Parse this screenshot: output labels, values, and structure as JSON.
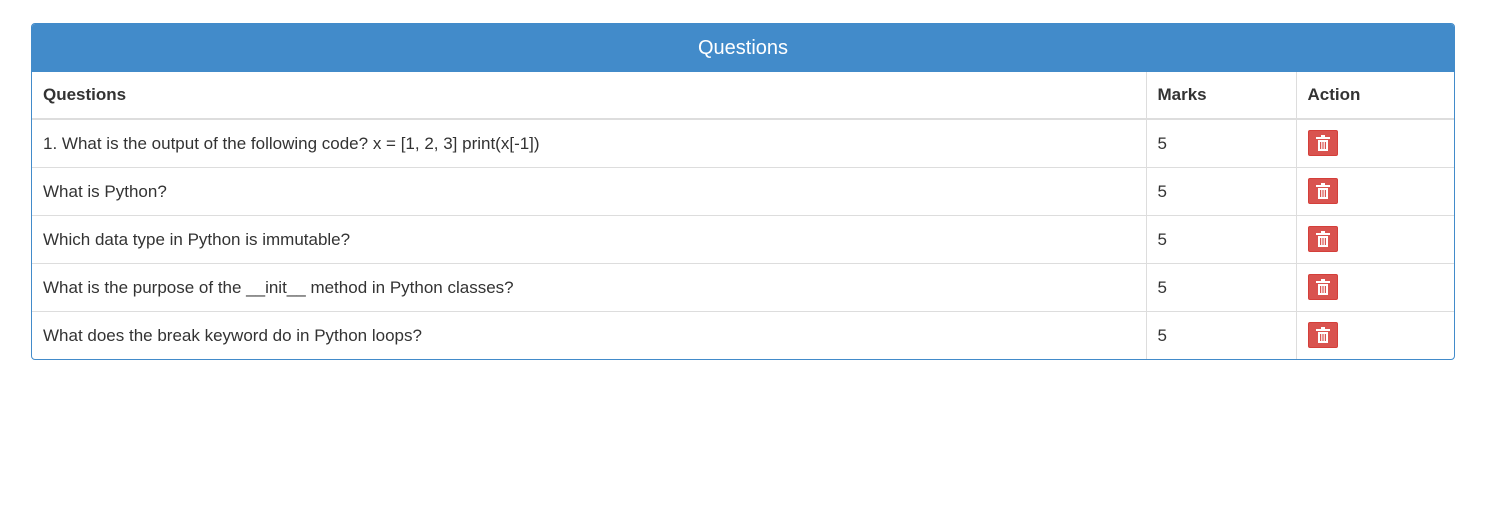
{
  "panel": {
    "title": "Questions"
  },
  "table": {
    "headers": {
      "question": "Questions",
      "marks": "Marks",
      "action": "Action"
    },
    "rows": [
      {
        "question": "1. What is the output of the following code? x = [1, 2, 3] print(x[-1])",
        "marks": "5",
        "action_icon": "trash-icon"
      },
      {
        "question": "What is Python?",
        "marks": "5",
        "action_icon": "trash-icon"
      },
      {
        "question": "Which data type in Python is immutable?",
        "marks": "5",
        "action_icon": "trash-icon"
      },
      {
        "question": "What is the purpose of the __init__ method in Python classes?",
        "marks": "5",
        "action_icon": "trash-icon"
      },
      {
        "question": "What does the break keyword do in Python loops?",
        "marks": "5",
        "action_icon": "trash-icon"
      }
    ]
  },
  "colors": {
    "primary": "#428bca",
    "danger": "#d9534f"
  }
}
